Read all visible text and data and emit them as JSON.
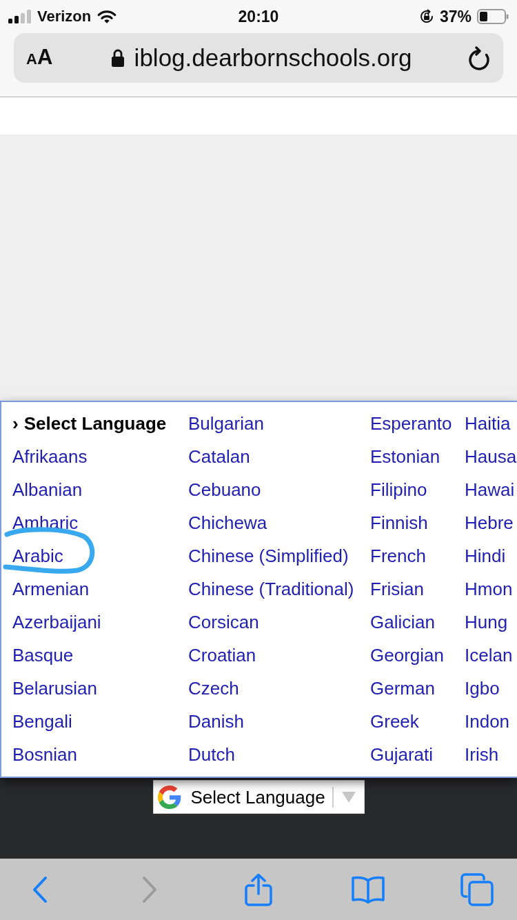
{
  "status_bar": {
    "carrier": "Verizon",
    "time": "20:10",
    "battery_percent": "37%"
  },
  "address_bar": {
    "reader_button": {
      "small_letter": "A",
      "large_letter": "A"
    },
    "url": "iblog.dearbornschools.org"
  },
  "language_menu": {
    "columns": [
      {
        "items": [
          {
            "label": "Select Language",
            "marker": "›",
            "selected": true,
            "circled": false
          },
          {
            "label": "Afrikaans",
            "selected": false,
            "circled": false
          },
          {
            "label": "Albanian",
            "selected": false,
            "circled": false
          },
          {
            "label": "Amharic",
            "selected": false,
            "circled": false
          },
          {
            "label": "Arabic",
            "selected": false,
            "circled": true
          },
          {
            "label": "Armenian",
            "selected": false,
            "circled": false
          },
          {
            "label": "Azerbaijani",
            "selected": false,
            "circled": false
          },
          {
            "label": "Basque",
            "selected": false,
            "circled": false
          },
          {
            "label": "Belarusian",
            "selected": false,
            "circled": false
          },
          {
            "label": "Bengali",
            "selected": false,
            "circled": false
          },
          {
            "label": "Bosnian",
            "selected": false,
            "circled": false
          }
        ]
      },
      {
        "items": [
          {
            "label": "Bulgarian",
            "selected": false,
            "circled": false
          },
          {
            "label": "Catalan",
            "selected": false,
            "circled": false
          },
          {
            "label": "Cebuano",
            "selected": false,
            "circled": false
          },
          {
            "label": "Chichewa",
            "selected": false,
            "circled": false
          },
          {
            "label": "Chinese (Simplified)",
            "selected": false,
            "circled": false
          },
          {
            "label": "Chinese (Traditional)",
            "selected": false,
            "circled": false
          },
          {
            "label": "Corsican",
            "selected": false,
            "circled": false
          },
          {
            "label": "Croatian",
            "selected": false,
            "circled": false
          },
          {
            "label": "Czech",
            "selected": false,
            "circled": false
          },
          {
            "label": "Danish",
            "selected": false,
            "circled": false
          },
          {
            "label": "Dutch",
            "selected": false,
            "circled": false
          }
        ]
      },
      {
        "items": [
          {
            "label": "Esperanto",
            "selected": false,
            "circled": false
          },
          {
            "label": "Estonian",
            "selected": false,
            "circled": false
          },
          {
            "label": "Filipino",
            "selected": false,
            "circled": false
          },
          {
            "label": "Finnish",
            "selected": false,
            "circled": false
          },
          {
            "label": "French",
            "selected": false,
            "circled": false
          },
          {
            "label": "Frisian",
            "selected": false,
            "circled": false
          },
          {
            "label": "Galician",
            "selected": false,
            "circled": false
          },
          {
            "label": "Georgian",
            "selected": false,
            "circled": false
          },
          {
            "label": "German",
            "selected": false,
            "circled": false
          },
          {
            "label": "Greek",
            "selected": false,
            "circled": false
          },
          {
            "label": "Gujarati",
            "selected": false,
            "circled": false
          }
        ]
      },
      {
        "items": [
          {
            "label": "Haitia",
            "selected": false,
            "circled": false
          },
          {
            "label": "Hausa",
            "selected": false,
            "circled": false
          },
          {
            "label": "Hawai",
            "selected": false,
            "circled": false
          },
          {
            "label": "Hebre",
            "selected": false,
            "circled": false
          },
          {
            "label": "Hindi",
            "selected": false,
            "circled": false
          },
          {
            "label": "Hmon",
            "selected": false,
            "circled": false
          },
          {
            "label": "Hung",
            "selected": false,
            "circled": false
          },
          {
            "label": "Icelan",
            "selected": false,
            "circled": false
          },
          {
            "label": "Igbo",
            "selected": false,
            "circled": false
          },
          {
            "label": "Indon",
            "selected": false,
            "circled": false
          },
          {
            "label": "Irish",
            "selected": false,
            "circled": false
          }
        ]
      }
    ]
  },
  "translate_widget": {
    "label": "Select Language"
  },
  "toolbar": {
    "buttons": [
      {
        "kind": "back",
        "disabled": false
      },
      {
        "kind": "forward",
        "disabled": true
      },
      {
        "kind": "share",
        "disabled": false
      },
      {
        "kind": "bookmarks",
        "disabled": false
      },
      {
        "kind": "tabs",
        "disabled": false
      }
    ]
  }
}
